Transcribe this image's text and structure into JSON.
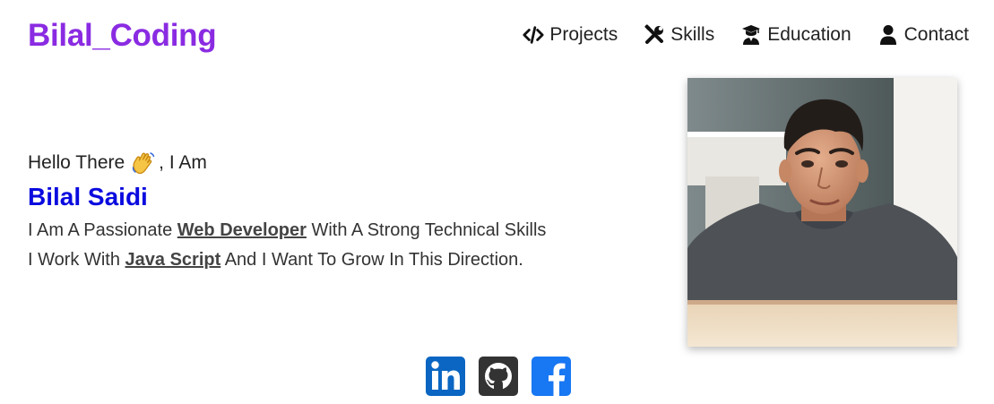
{
  "header": {
    "logo": "Bilal_Coding",
    "nav": [
      {
        "label": "Projects",
        "icon": "code-icon"
      },
      {
        "label": "Skills",
        "icon": "tools-icon"
      },
      {
        "label": "Education",
        "icon": "graduate-icon"
      },
      {
        "label": "Contact",
        "icon": "user-icon"
      }
    ]
  },
  "hero": {
    "greeting_prefix": "Hello There",
    "greeting_suffix": ", I Am",
    "wave_icon": "waving-hand-icon",
    "name": "Bilal Saidi",
    "line1_pre": "I Am A Passionate ",
    "line1_highlight": "Web Developer",
    "line1_post": " With A Strong Technical Skills",
    "line2_pre": "I Work With ",
    "line2_highlight": "Java Script",
    "line2_post": " And I Want To Grow In This Direction."
  },
  "profile_photo": {
    "icon": "profile-photo"
  },
  "socials": [
    {
      "icon": "linkedin-icon",
      "color": "#0a66c2"
    },
    {
      "icon": "github-icon",
      "color": "#333333"
    },
    {
      "icon": "facebook-icon",
      "color": "#1877f2"
    }
  ],
  "colors": {
    "brand": "#8a2be2",
    "name": "#0a0adf"
  }
}
